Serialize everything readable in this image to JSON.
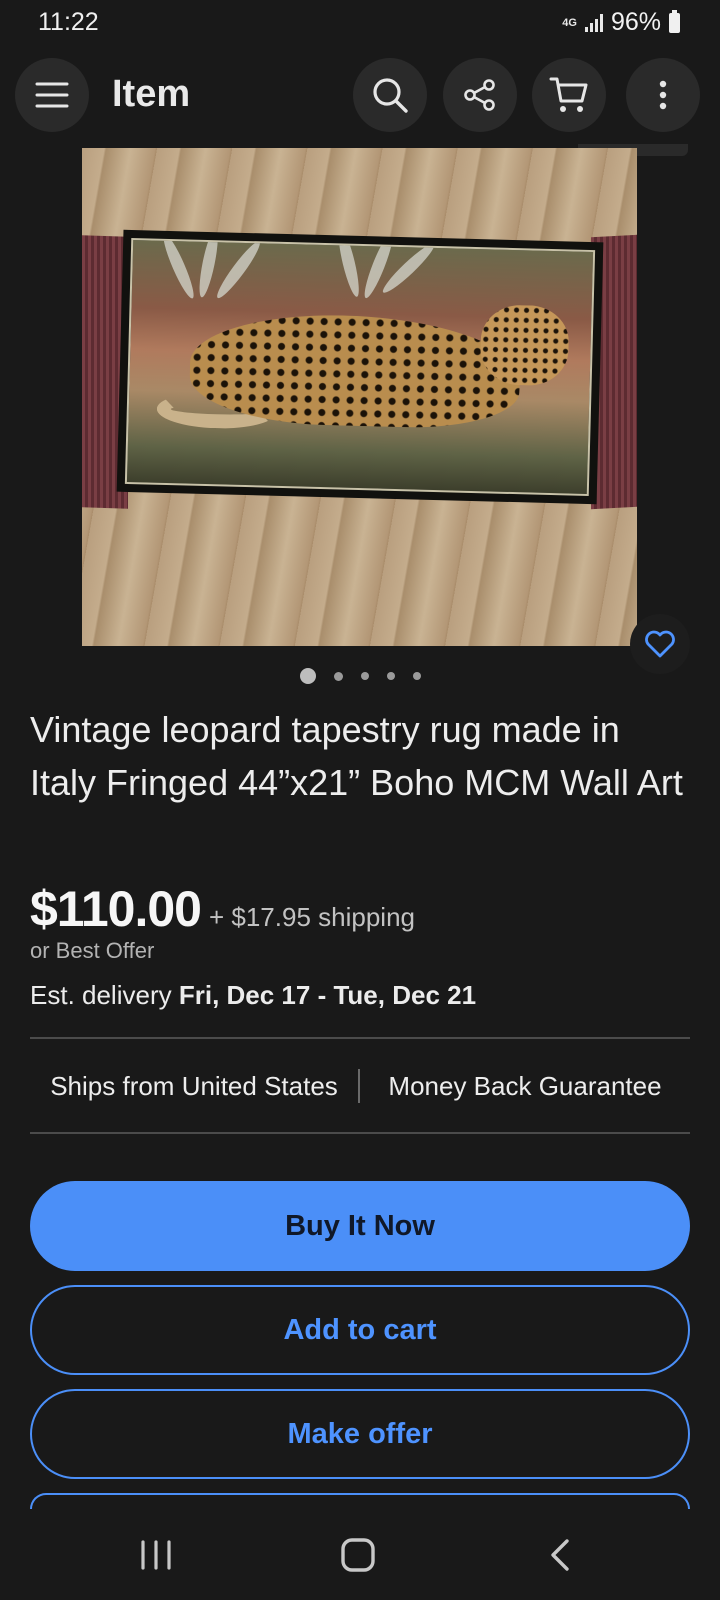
{
  "status_bar": {
    "time": "11:22",
    "network": "4G",
    "battery": "96%"
  },
  "app_bar": {
    "title": "Item",
    "icons": [
      "menu-icon",
      "search-icon",
      "share-icon",
      "cart-icon",
      "more-vert-icon"
    ]
  },
  "gallery": {
    "image_count": 5,
    "active_index": 0
  },
  "listing": {
    "title": "Vintage leopard tapestry rug made in Italy Fringed 44”x21” Boho MCM Wall Art",
    "price": "$110.00",
    "shipping": "+ $17.95 shipping",
    "best_offer": "or Best Offer",
    "delivery_label": "Est. delivery",
    "delivery_dates": "Fri, Dec 17 - Tue, Dec 21"
  },
  "badges": {
    "ships_from": "Ships from United States",
    "guarantee": "Money Back Guarantee"
  },
  "actions": {
    "buy_now": "Buy It Now",
    "add_to_cart": "Add to cart",
    "make_offer": "Make offer"
  },
  "colors": {
    "accent": "#4b8ff8",
    "background": "#191919"
  }
}
